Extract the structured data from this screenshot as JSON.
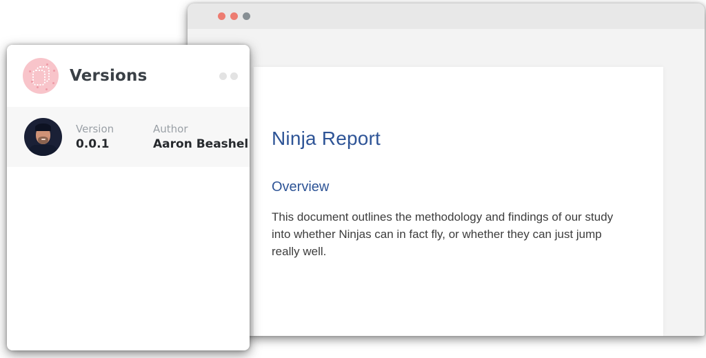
{
  "window": {
    "buttons": [
      {
        "name": "close",
        "color": "#ed7c71"
      },
      {
        "name": "minimize",
        "color": "#ed7c71"
      },
      {
        "name": "maximize",
        "color": "#878f94"
      }
    ]
  },
  "document": {
    "title": "Ninja Report",
    "section_heading": "Overview",
    "paragraph": "This document outlines the methodology and findings of our study into whether Ninjas can in fact fly, or whether they can just jump really well.",
    "heading_color": "#2e5496"
  },
  "versions_panel": {
    "title": "Versions",
    "icon_color": "#f8c4ca",
    "record": {
      "version_label": "Version",
      "version_value": "0.0.1",
      "author_label": "Author",
      "author_value": "Aaron Beashel"
    }
  }
}
